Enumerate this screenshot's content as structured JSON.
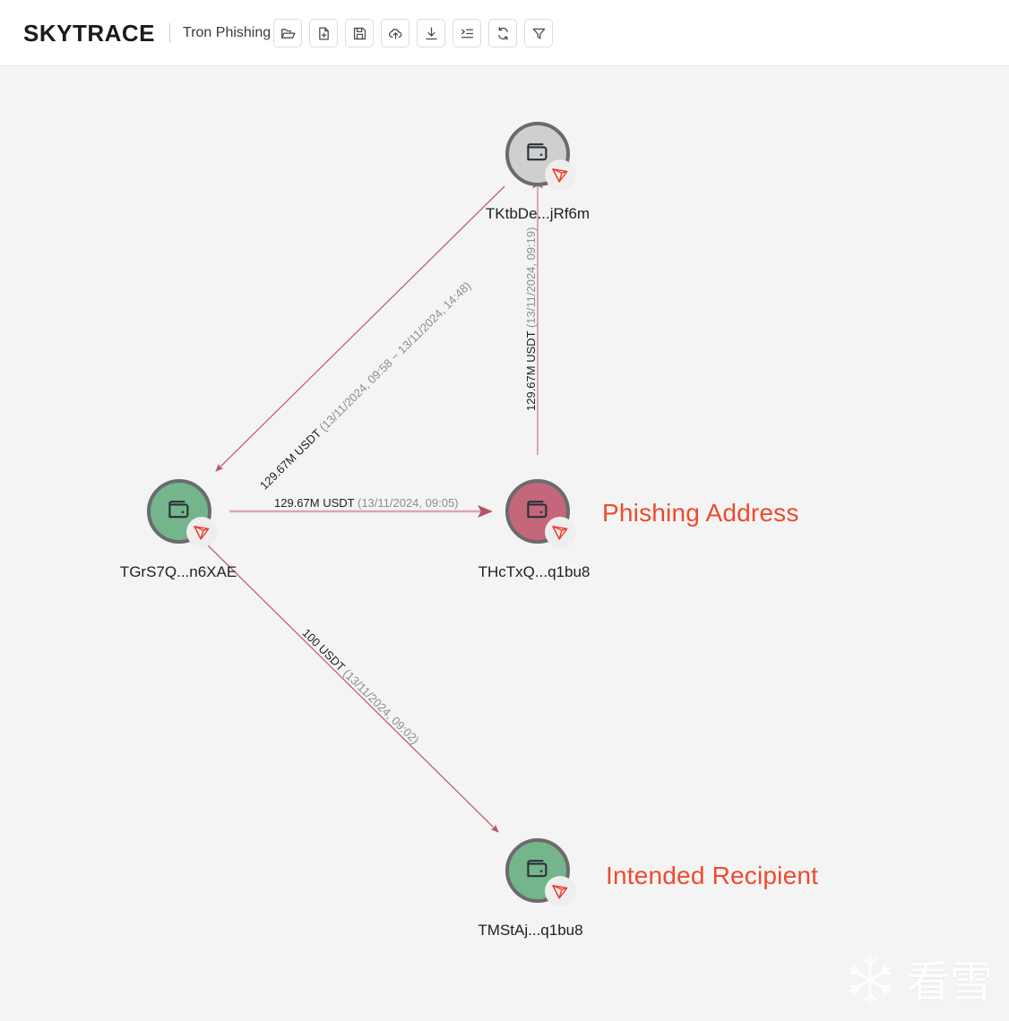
{
  "header": {
    "app_title": "SKYTRACE",
    "project_name": "Tron Phishing Vi",
    "toolbar": [
      {
        "name": "open-folder-icon",
        "label": "Open"
      },
      {
        "name": "new-file-icon",
        "label": "New"
      },
      {
        "name": "save-icon",
        "label": "Save"
      },
      {
        "name": "cloud-upload-icon",
        "label": "Upload"
      },
      {
        "name": "download-icon",
        "label": "Download"
      },
      {
        "name": "list-indent-icon",
        "label": "List"
      },
      {
        "name": "refresh-icon",
        "label": "Refresh"
      },
      {
        "name": "filter-icon",
        "label": "Filter"
      }
    ]
  },
  "graph": {
    "nodes": [
      {
        "id": "tktbde",
        "label": "TKtbDe...jRf6m",
        "color": "grey",
        "color_hex": "#cfcfcf",
        "chain_badge": "tron-logo-icon",
        "annotation": null
      },
      {
        "id": "tgrs7q",
        "label": "TGrS7Q...n6XAE",
        "color": "green",
        "color_hex": "#74b58c",
        "chain_badge": "tron-logo-icon",
        "annotation": null
      },
      {
        "id": "thctxq",
        "label": "THcTxQ...q1bu8",
        "color": "red",
        "color_hex": "#c4677a",
        "chain_badge": "tron-logo-icon",
        "annotation": "Phishing Address"
      },
      {
        "id": "tmstaj",
        "label": "TMStAj...q1bu8",
        "color": "green",
        "color_hex": "#74b58c",
        "chain_badge": "tron-logo-icon",
        "annotation": "Intended Recipient"
      }
    ],
    "edges": [
      {
        "id": "e-tktbde-tgrs7q",
        "from": "tktbde",
        "to": "tgrs7q",
        "amount": "129.67M USDT",
        "time": "(13/11/2024, 09:58 ~ 13/11/2024, 14:48)"
      },
      {
        "id": "e-thctxq-tktbde",
        "from": "thctxq",
        "to": "tktbde",
        "amount": "129.67M USDT",
        "time": "(13/11/2024, 09:19)"
      },
      {
        "id": "e-tgrs7q-thctxq",
        "from": "tgrs7q",
        "to": "thctxq",
        "amount": "129.67M USDT",
        "time": "(13/11/2024, 09:05)"
      },
      {
        "id": "e-tgrs7q-tmstaj",
        "from": "tgrs7q",
        "to": "tmstaj",
        "amount": "100 USDT",
        "time": "(13/11/2024, 09:02)"
      }
    ],
    "annotation_color": "#ef4a2c",
    "edge_color": "#c97f8c",
    "canvas_bg": "#f4f4f4"
  },
  "watermark": {
    "icon": "snowflake-icon",
    "text": "看雪"
  }
}
